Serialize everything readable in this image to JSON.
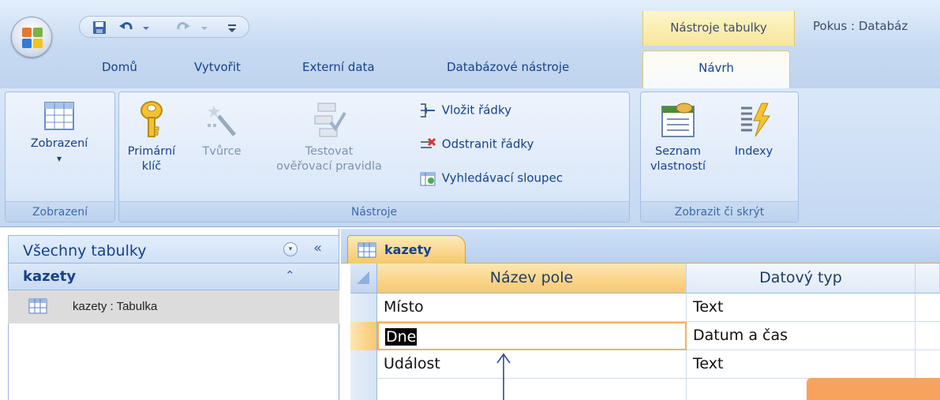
{
  "app_title": "Pokus : Databáz",
  "contextual_tab_label": "Nástroje tabulky",
  "tabs": {
    "home": "Domů",
    "create": "Vytvořit",
    "external_data": "Externí data",
    "db_tools": "Databázové nástroje",
    "design": "Návrh"
  },
  "ribbon": {
    "views_group": {
      "label": "Zobrazení",
      "view_button": "Zobrazení",
      "view_arrow": "▾"
    },
    "tools_group": {
      "label": "Nástroje",
      "primary_key_l1": "Primární",
      "primary_key_l2": "klíč",
      "builder": "Tvůrce",
      "test_rules_l1": "Testovat",
      "test_rules_l2": "ověřovací pravidla",
      "insert_rows": "Vložit řádky",
      "delete_rows": "Odstranit řádky",
      "lookup_column": "Vyhledávací sloupec"
    },
    "show_group": {
      "label": "Zobrazit či skrýt",
      "property_sheet_l1": "Seznam",
      "property_sheet_l2": "vlastností",
      "indexes": "Indexy"
    }
  },
  "nav_pane": {
    "title": "Všechny tabulky",
    "menu_glyph": "▾",
    "collapse_glyph": "«",
    "group": "kazety",
    "group_chevron": "⌃",
    "item": "kazety : Tabulka"
  },
  "document": {
    "tab_label": "kazety",
    "columns": [
      "Název pole",
      "Datový typ"
    ],
    "rows": [
      {
        "name": "Místo",
        "type": "Text"
      },
      {
        "name": "Dne",
        "type": "Datum a čas"
      },
      {
        "name": "Událost",
        "type": "Text"
      },
      {
        "name": "",
        "type": ""
      }
    ]
  },
  "colors": {
    "accent": "#f7a35c",
    "ribbon_text": "#15428b",
    "contextual_tab": "#f7e59a"
  }
}
